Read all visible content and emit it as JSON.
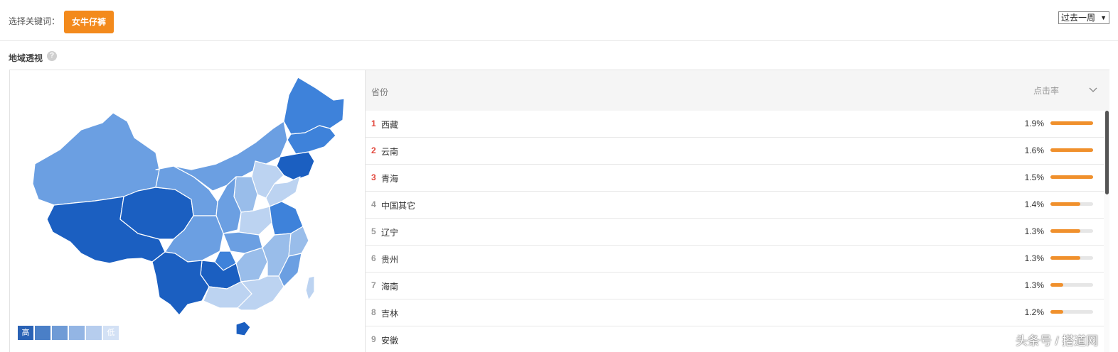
{
  "keyword": {
    "label": "选择关键词：",
    "value": "女牛仔裤"
  },
  "period": {
    "selected": "过去一周"
  },
  "section": {
    "title": "地域透视",
    "help_icon": "question-circle-icon"
  },
  "legend": {
    "high": "高",
    "low": "低",
    "colors": [
      "#2a62b5",
      "#4a7fc7",
      "#6f9bd6",
      "#93b5e4",
      "#b6cdee",
      "#d3e1f5"
    ]
  },
  "map_colors": {
    "darkest": "#1b5fc1",
    "dark": "#3e82da",
    "medium": "#6b9fe2",
    "light": "#99bdea",
    "lightest": "#bcd3f1"
  },
  "table": {
    "col_province": "省份",
    "col_ctr": "点击率",
    "rows": [
      {
        "rank": "1",
        "province": "西藏",
        "pct": "1.9%",
        "level": 1.0
      },
      {
        "rank": "2",
        "province": "云南",
        "pct": "1.6%",
        "level": 1.0
      },
      {
        "rank": "3",
        "province": "青海",
        "pct": "1.5%",
        "level": 1.0
      },
      {
        "rank": "4",
        "province": "中国其它",
        "pct": "1.4%",
        "level": 0.7
      },
      {
        "rank": "5",
        "province": "辽宁",
        "pct": "1.3%",
        "level": 0.7
      },
      {
        "rank": "6",
        "province": "贵州",
        "pct": "1.3%",
        "level": 0.7
      },
      {
        "rank": "7",
        "province": "海南",
        "pct": "1.3%",
        "level": 0.3
      },
      {
        "rank": "8",
        "province": "吉林",
        "pct": "1.2%",
        "level": 0.3
      },
      {
        "rank": "9",
        "province": "安徽",
        "pct": "",
        "level": 0
      }
    ]
  },
  "watermark": "头条号 / 搭道网"
}
